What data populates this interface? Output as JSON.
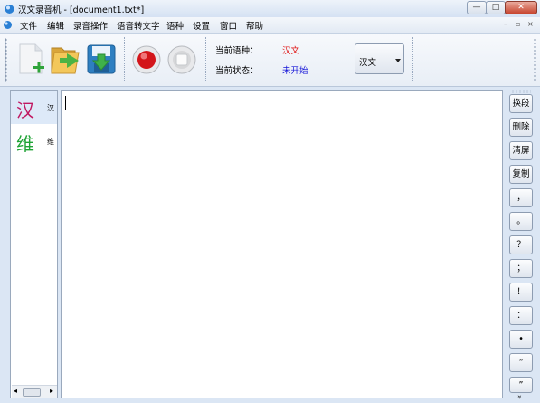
{
  "window": {
    "title": "汉文录音机 - [document1.txt*]",
    "min": "—",
    "max": "□",
    "close": "✕"
  },
  "menu": {
    "items": [
      "文件",
      "编辑",
      "录音操作",
      "语音转文字",
      "语种",
      "设置",
      "窗口",
      "帮助"
    ],
    "mdi": {
      "min": "–",
      "restore": "▫",
      "close": "×"
    }
  },
  "toolbar": {
    "current_language_label": "当前语种：",
    "current_language_value": "汉文",
    "current_status_label": "当前状态：",
    "current_status_value": "未开始",
    "language_select_value": "汉文",
    "language_value_color": "#e01818",
    "status_value_color": "#1818d8"
  },
  "languages": [
    {
      "char": "汉",
      "small": "汉",
      "color": "#c01861",
      "selected": true
    },
    {
      "char": "维",
      "small": "维",
      "color": "#1ea335",
      "selected": false
    }
  ],
  "side_buttons": [
    "换段",
    "删除",
    "清屏",
    "复制",
    "，",
    "。",
    "？",
    "；",
    "！",
    "：",
    "•",
    "“",
    "”"
  ],
  "side_more": "»",
  "scroll": {
    "left": "◂",
    "right": "▸"
  }
}
